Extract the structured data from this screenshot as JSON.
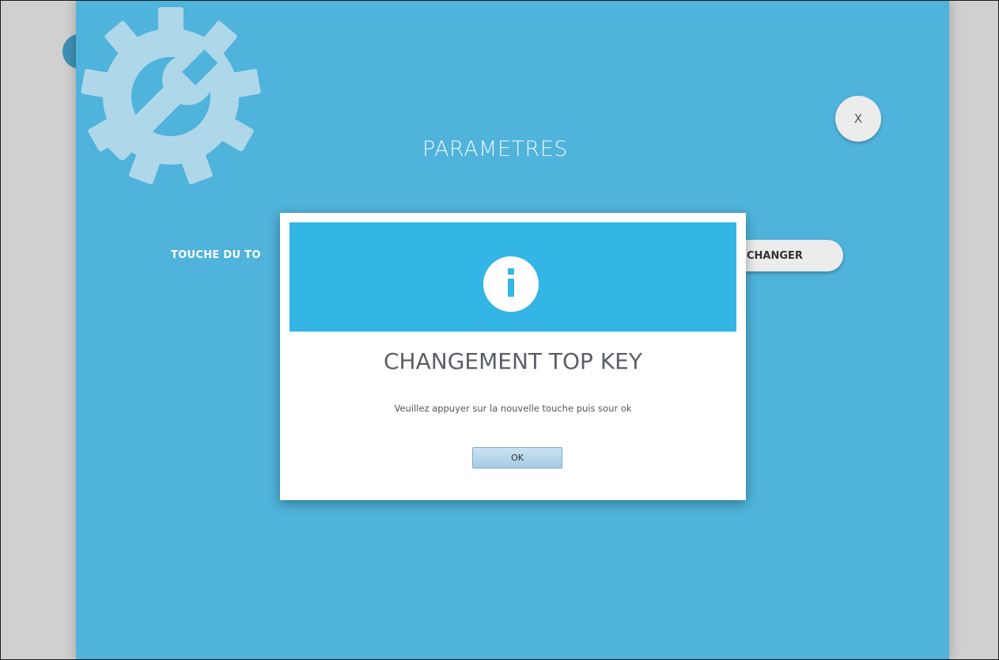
{
  "settings": {
    "title": "PARAMETRES",
    "close_label": "X",
    "key_label": "TOUCHE DU TO",
    "change_label": "CHANGER"
  },
  "dialog": {
    "icon": "info-icon",
    "title": "CHANGEMENT TOP KEY",
    "message": "Veuillez appuyer sur la nouvelle touche puis sour ok",
    "ok_label": "OK"
  },
  "colors": {
    "panel": "#4fb3db",
    "dialog_header": "#33b5e5",
    "gear": "#b3dbec"
  }
}
